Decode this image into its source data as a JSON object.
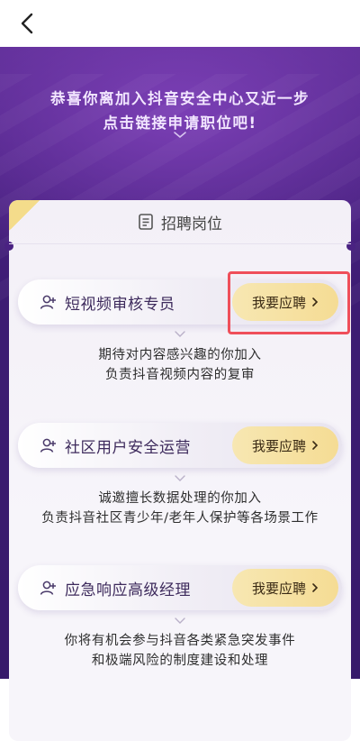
{
  "nav": {
    "back_icon": "chevron-left-icon"
  },
  "hero": {
    "line1": "恭喜你离加入抖音安全中心又近一步",
    "line2": "点击链接申请职位吧!"
  },
  "card": {
    "header_icon": "document-icon",
    "header_title": "招聘岗位"
  },
  "jobs": [
    {
      "title": "短视频审核专员",
      "apply_label": "我要应聘",
      "desc1": "期待对内容感兴趣的你加入",
      "desc2": "负责抖音视频内容的复审"
    },
    {
      "title": "社区用户安全运营",
      "apply_label": "我要应聘",
      "desc1": "诚邀擅长数据处理的你加入",
      "desc2": "负责抖音社区青少年/老年人保护等各场景工作"
    },
    {
      "title": "应急响应高级经理",
      "apply_label": "我要应聘",
      "desc1": "你将有机会参与抖音各类紧急突发事件",
      "desc2": "和极端风险的制度建设和处理"
    }
  ],
  "colors": {
    "hero_top": "#5a2c92",
    "hero_bottom": "#371a6a",
    "apply_button": "#f5dc94",
    "highlight": "#ef4f5a"
  }
}
